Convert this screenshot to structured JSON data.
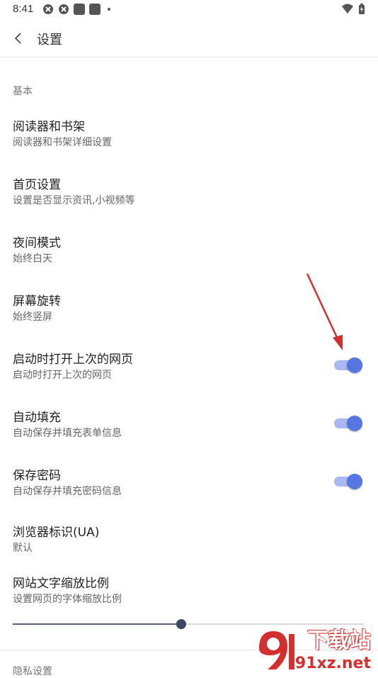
{
  "status": {
    "time": "8:41"
  },
  "header": {
    "title": "设置"
  },
  "section_basic": {
    "label": "基本"
  },
  "items": [
    {
      "title": "阅读器和书架",
      "subtitle": "阅读器和书架详细设置"
    },
    {
      "title": "首页设置",
      "subtitle": "设置是否显示资讯,小视频等"
    },
    {
      "title": "夜间模式",
      "subtitle": "始终白天"
    },
    {
      "title": "屏幕旋转",
      "subtitle": "始终竖屏"
    },
    {
      "title": "启动时打开上次的网页",
      "subtitle": "启动时打开上次的网页",
      "toggle_on": true
    },
    {
      "title": "自动填充",
      "subtitle": "自动保存并填充表单信息",
      "toggle_on": true
    },
    {
      "title": "保存密码",
      "subtitle": "自动保存并填充密码信息",
      "toggle_on": true
    },
    {
      "title": "浏览器标识(UA)",
      "subtitle": "默认"
    },
    {
      "title": "网站文字缩放比例",
      "subtitle": "设置网页的字体缩放比例"
    }
  ],
  "font_scale_slider": {
    "value_fraction": 0.48
  },
  "next_section": {
    "label": "隐私设置"
  },
  "watermark": {
    "top": "下载站",
    "bottom": "91xz.net"
  },
  "colors": {
    "accent": "#5776e0",
    "arrow": "#d32f2f"
  }
}
